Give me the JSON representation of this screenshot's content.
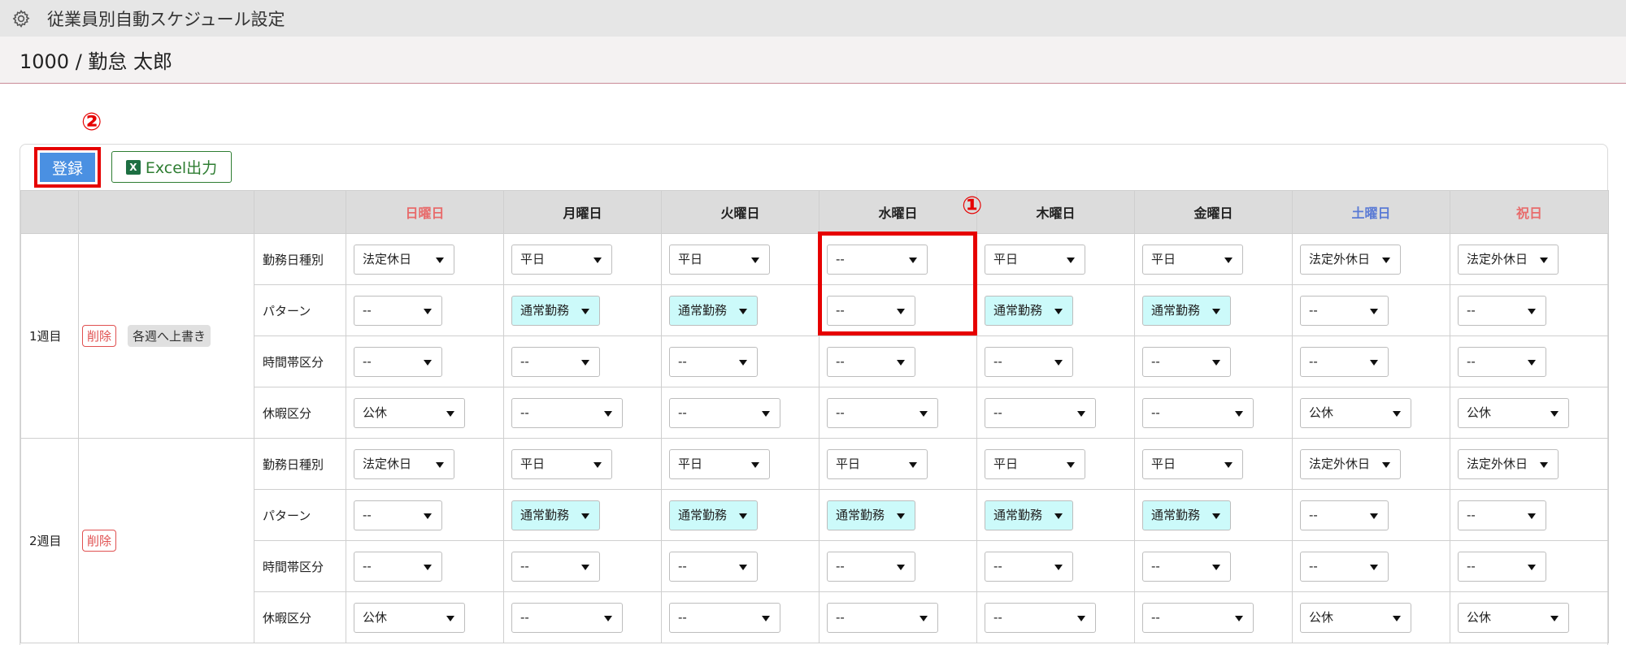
{
  "header": {
    "icon": "gear-icon",
    "title": "従業員別自動スケジュール設定"
  },
  "employee": {
    "label": "1000 / 勤怠 太郎"
  },
  "callouts": {
    "register": "②",
    "wednesday": "①"
  },
  "toolbar": {
    "register_label": "登録",
    "excel_label": "Excel出力",
    "excel_icon": "excel-icon",
    "excel_icon_char": "X"
  },
  "days": [
    "日曜日",
    "月曜日",
    "火曜日",
    "水曜日",
    "木曜日",
    "金曜日",
    "土曜日",
    "祝日"
  ],
  "row_labels": [
    "勤務日種別",
    "パターン",
    "時間帯区分",
    "休暇区分"
  ],
  "colors": {
    "sunday": "#e86b6b",
    "saturday": "#5b7bd5",
    "holiday": "#e86b6b",
    "pattern_highlight": "#ccfafa",
    "register_button": "#4a90e2",
    "annotation": "#e60000"
  },
  "weeks": [
    {
      "label": "1週目",
      "delete_label": "削除",
      "overwrite_label": "各週へ上書き",
      "rows": {
        "day_type": [
          "法定休日",
          "平日",
          "平日",
          "--",
          "平日",
          "平日",
          "法定外休日",
          "法定外休日"
        ],
        "pattern": [
          "--",
          "通常勤務",
          "通常勤務",
          "--",
          "通常勤務",
          "通常勤務",
          "--",
          "--"
        ],
        "time_zone": [
          "--",
          "--",
          "--",
          "--",
          "--",
          "--",
          "--",
          "--"
        ],
        "leave": [
          "公休",
          "--",
          "--",
          "--",
          "--",
          "--",
          "公休",
          "公休"
        ]
      }
    },
    {
      "label": "2週目",
      "delete_label": "削除",
      "rows": {
        "day_type": [
          "法定休日",
          "平日",
          "平日",
          "平日",
          "平日",
          "平日",
          "法定外休日",
          "法定外休日"
        ],
        "pattern": [
          "--",
          "通常勤務",
          "通常勤務",
          "通常勤務",
          "通常勤務",
          "通常勤務",
          "--",
          "--"
        ],
        "time_zone": [
          "--",
          "--",
          "--",
          "--",
          "--",
          "--",
          "--",
          "--"
        ],
        "leave": [
          "公休",
          "--",
          "--",
          "--",
          "--",
          "--",
          "公休",
          "公休"
        ]
      }
    }
  ]
}
